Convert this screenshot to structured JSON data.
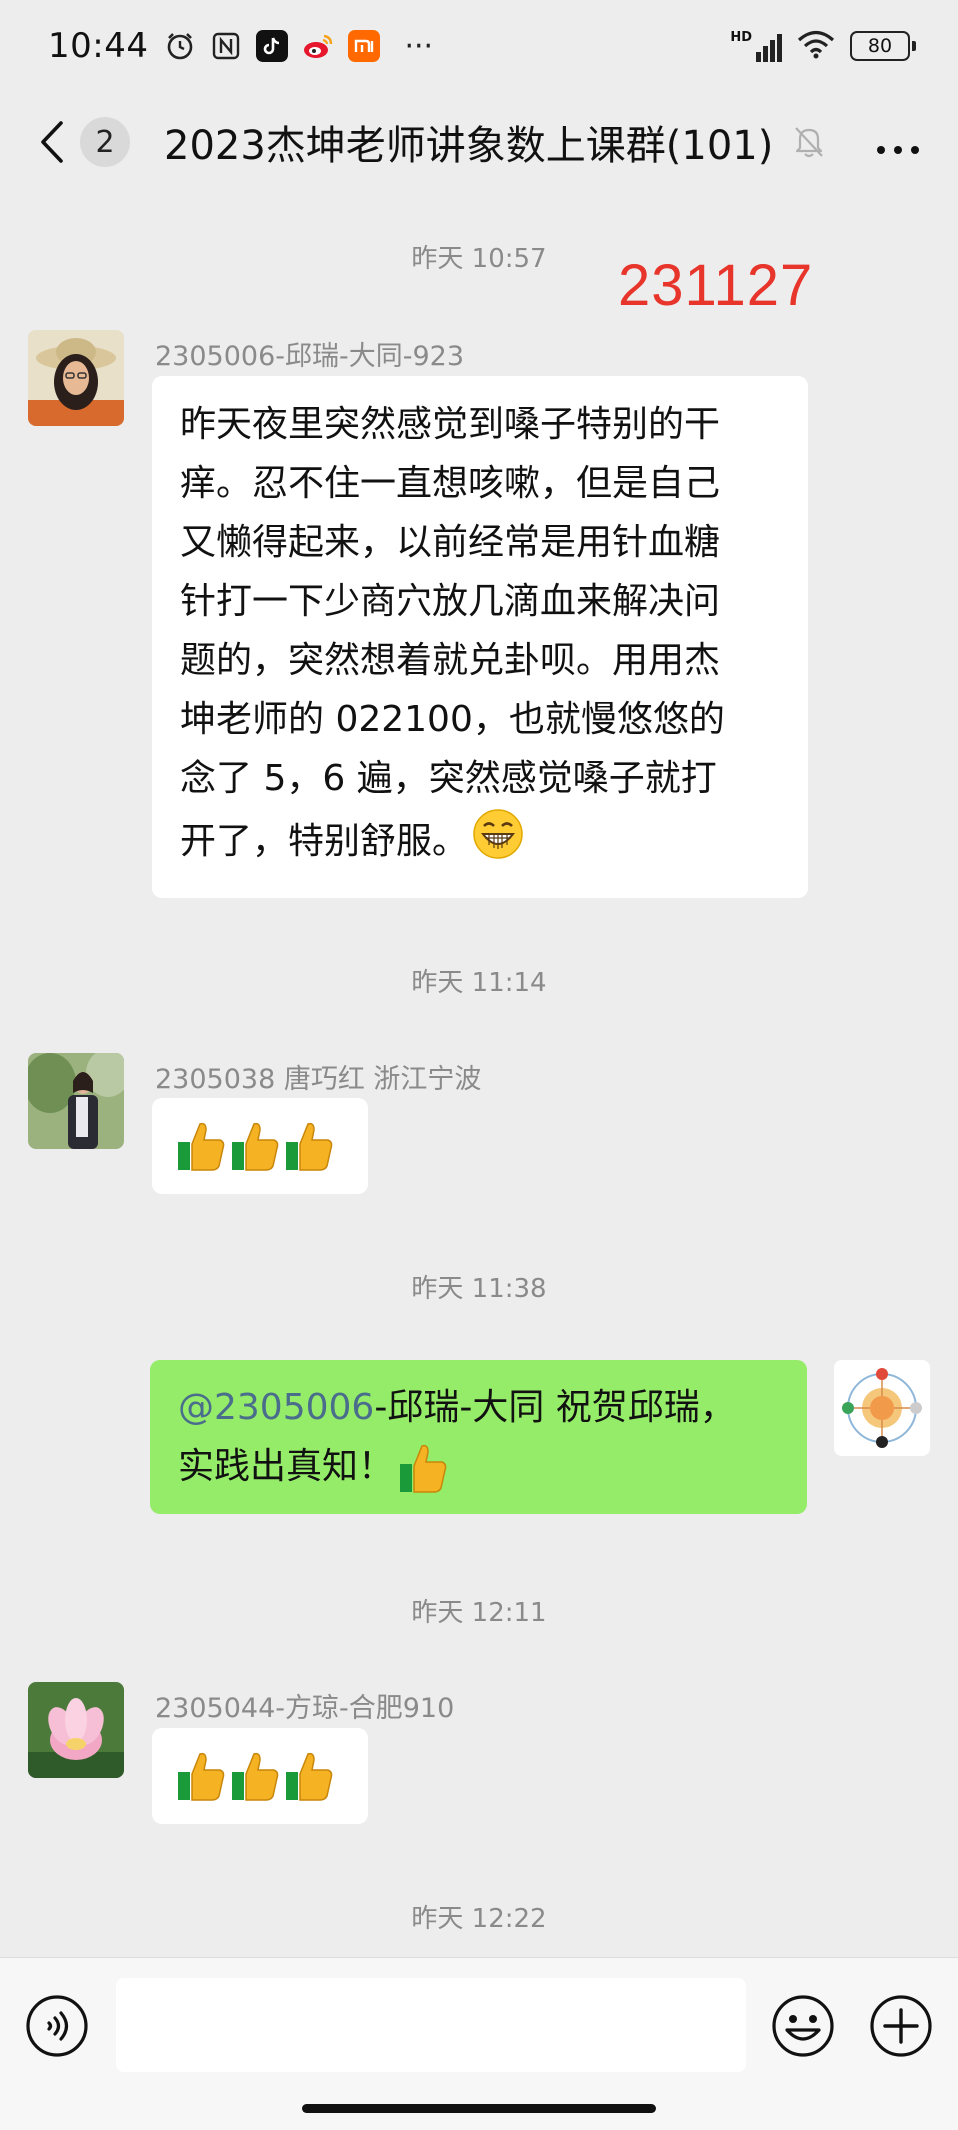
{
  "status_bar": {
    "time": "10:44",
    "icons": [
      "alarm-icon",
      "nfc-icon",
      "tiktok-icon",
      "weibo-icon",
      "mi-icon"
    ],
    "more": "···",
    "network": "HD",
    "battery": "80"
  },
  "nav": {
    "unread_count": "2",
    "title": "2023杰坤老师讲象数上课群(101)"
  },
  "annotation": "231127",
  "timestamps": [
    "昨天 10:57",
    "昨天 11:14",
    "昨天 11:38",
    "昨天 12:11",
    "昨天 12:22"
  ],
  "messages": [
    {
      "sender": "2305006-邱瑞-大同-923",
      "text": "昨天夜里突然感觉到嗓子特别的干\n痒。忍不住一直想咳嗽，但是自己\n又懒得起来，以前经常是用针血糖\n针打一下少商穴放几滴血来解决问\n题的，突然想着就兑卦呗。用用杰\n坤老师的 022100，也就慢悠悠的\n念了 5，6 遍，突然感觉嗓子就打\n开了，特别舒服。",
      "emoji": "grinning-emoji"
    },
    {
      "sender": "2305038  唐巧红    浙江宁波",
      "emoji": "thumbs-up x3"
    },
    {
      "mention": "@2305006",
      "text_line1": "-邱瑞-大同  祝贺邱瑞，",
      "text_line2": "实践出真知！",
      "emoji": "thumbs-up"
    },
    {
      "sender": "2305044-方琼-合肥910",
      "emoji": "thumbs-up x3"
    }
  ],
  "colors": {
    "background": "#ededed",
    "bubble_white": "#ffffff",
    "bubble_green": "#95ec69",
    "annotation_red": "#e8352b",
    "mention_blue": "#4a6d8c"
  }
}
